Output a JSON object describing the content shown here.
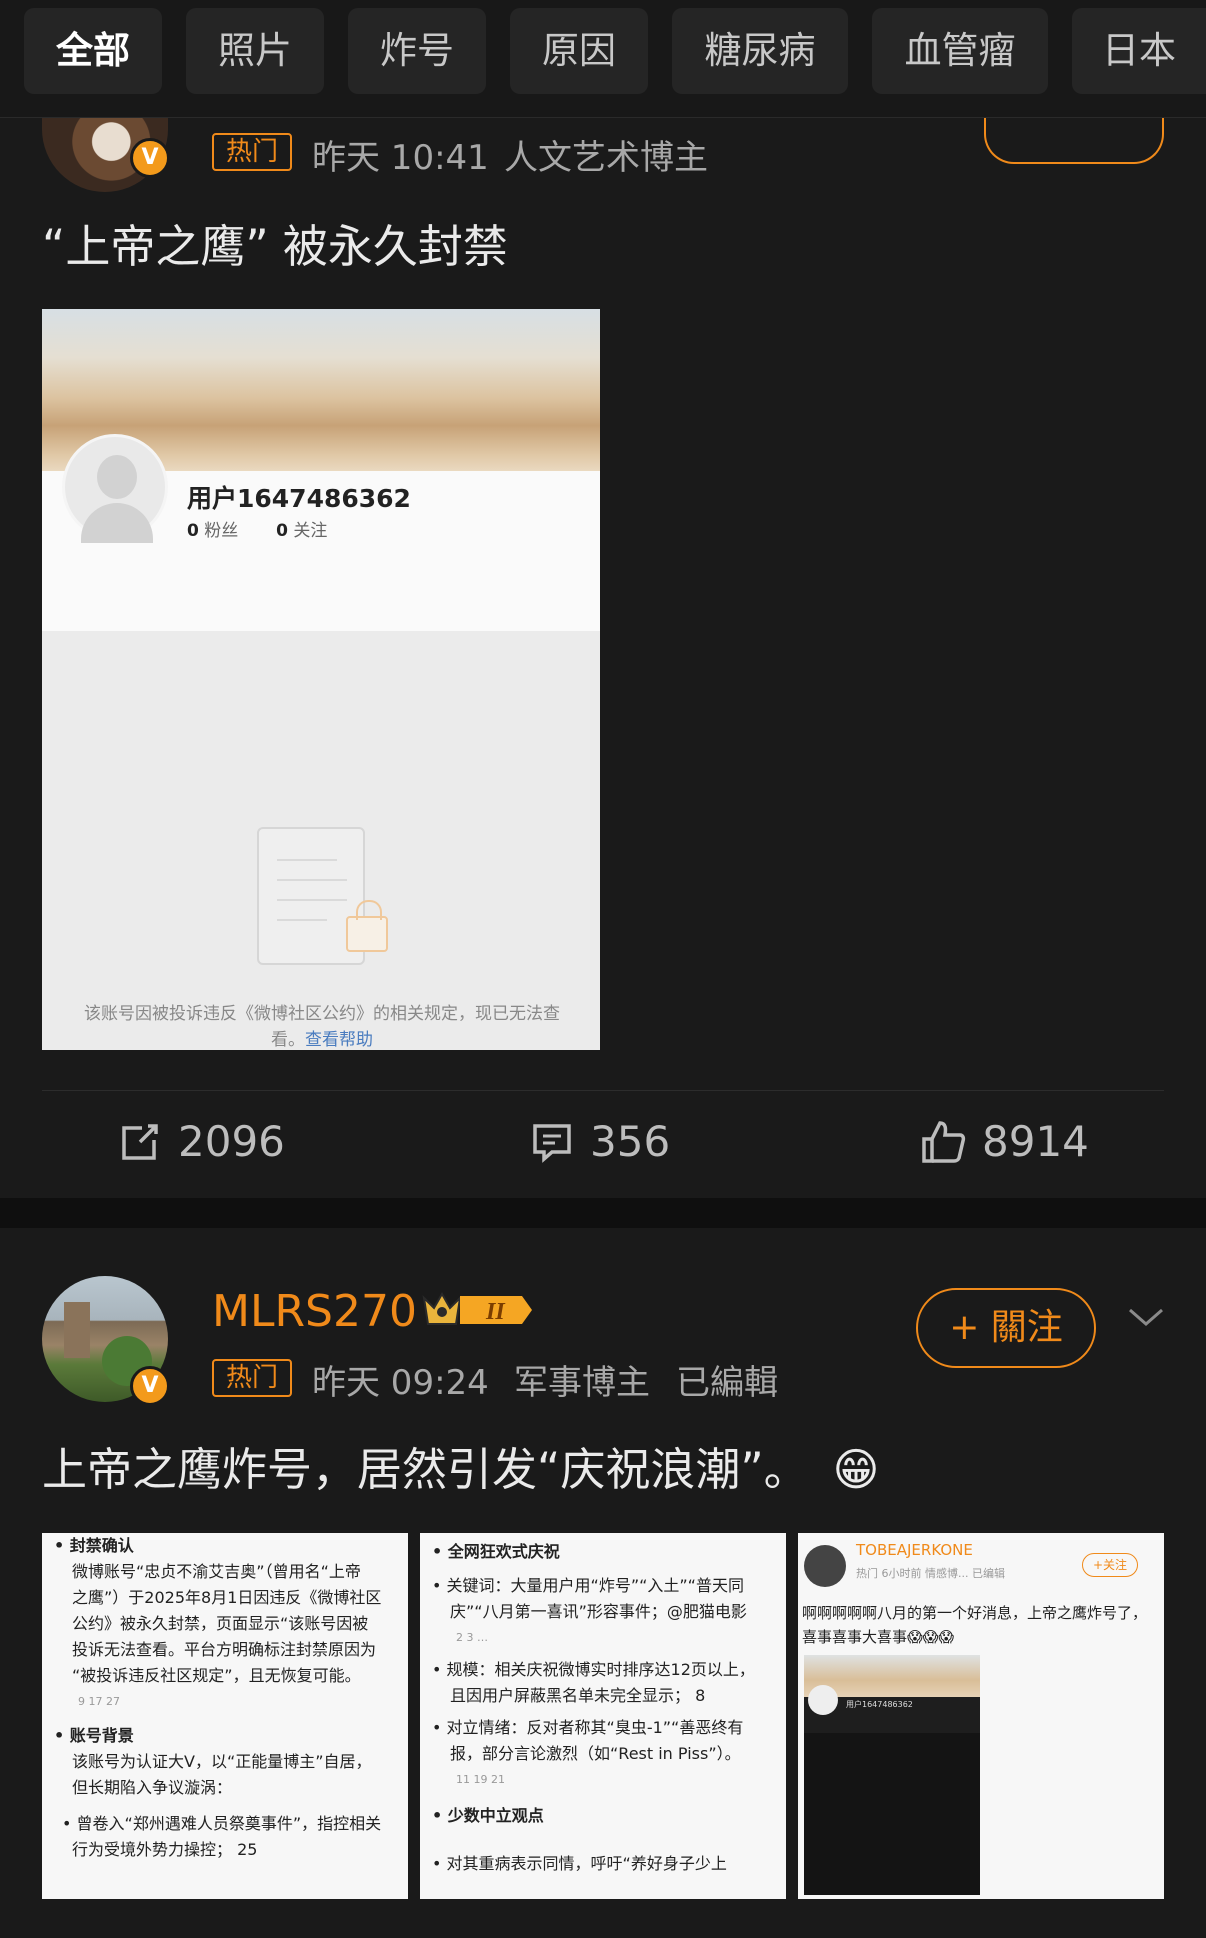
{
  "tabs": [
    {
      "label": "全部",
      "active": true
    },
    {
      "label": "照片",
      "active": false
    },
    {
      "label": "炸号",
      "active": false
    },
    {
      "label": "原因",
      "active": false
    },
    {
      "label": "糖尿病",
      "active": false
    },
    {
      "label": "血管瘤",
      "active": false
    },
    {
      "label": "日本",
      "active": false
    }
  ],
  "post1": {
    "hot_badge": "热门",
    "time": "昨天 10:41",
    "role": "人文艺术博主",
    "text": "“上帝之鹰” 被永久封禁",
    "screenshot": {
      "username": "用户1647486362",
      "fans_count": "0",
      "fans_label": "粉丝",
      "follow_count": "0",
      "follow_label": "关注",
      "message": "该账号因被投诉违反《微博社区公约》的相关规定，现已无法查看。",
      "help_link": "查看帮助"
    },
    "actions": {
      "repost": "2096",
      "comment": "356",
      "like": "8914"
    }
  },
  "post2": {
    "username": "MLRS270",
    "level_badge": "II",
    "follow_label": "+ 關注",
    "hot_badge": "热门",
    "time": "昨天 09:24",
    "role": "军事博主",
    "edited": "已編輯",
    "text": "上帝之鹰炸号，居然引发“庆祝浪潮”。",
    "emoji": "😁",
    "thumb1": {
      "lines": [
        "• 封禁确认",
        "微博账号“忠贞不渝艾吉奥”（曾用名“上帝",
        "之鹰”）于2025年8月1日因违反《微博社区",
        "公约》被永久封禁，页面显示“该账号因被",
        "投诉无法查看。平台方明确标注封禁原因为",
        "“被投诉违反社区规定”，且无恢复可能。",
        "9   17   27",
        "• 账号背景",
        "该账号为认证大V，以“正能量博主”自居，",
        "但长期陷入争议漩涡：",
        "• 曾卷入“郑州遇难人员祭奠事件”，指控相关",
        "行为受境外势力操控；  25"
      ]
    },
    "thumb2": {
      "lines": [
        "• 全网狂欢式庆祝",
        "• 关键词：大量用户用“炸号”“入土”“普天同",
        "庆”“八月第一喜讯”形容事件；@肥猫电影",
        "2   3   …",
        "• 规模：相关庆祝微博实时排序达12页以上，",
        "且因用户屏蔽黑名单未完全显示；  8",
        "• 对立情绪：反对者称其“臭虫-1”“善恶终有",
        "报，部分言论激烈（如“Rest in Piss”）。",
        "11   19   21",
        "• 少数中立观点",
        "• 对其重病表示同情，呼吁“养好身子少上"
      ]
    },
    "thumb3": {
      "username": "TOBEAJERKONE",
      "meta": "热门  6小时前  情感博...  已编辑",
      "follow": "+关注",
      "text": "啊啊啊啊啊八月的第一个好消息，上帝之鹰炸号了，喜事喜事大喜事😱😱😱",
      "inner_user": "用户1647486362"
    }
  },
  "colors": {
    "accent": "#f08a1a",
    "background": "#1a1a1a",
    "text": "#eaeaea",
    "muted": "#a8a8a8"
  }
}
